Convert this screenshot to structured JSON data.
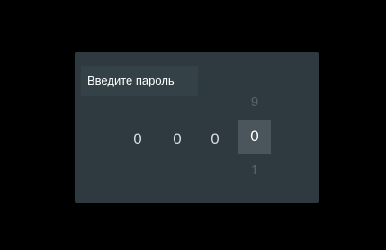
{
  "dialog": {
    "title": "Введите пароль",
    "digits": [
      "0",
      "0",
      "0",
      "0"
    ],
    "active_digit": {
      "above": "9",
      "below": "1"
    }
  }
}
